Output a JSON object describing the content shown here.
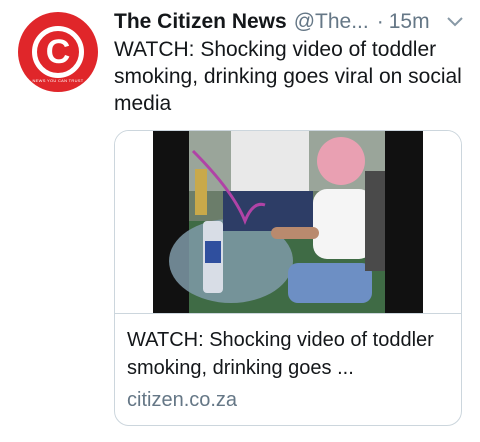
{
  "tweet": {
    "author_name": "The Citizen News",
    "handle": "@The...",
    "separator": "·",
    "time": "15m",
    "text": "WATCH: Shocking video of toddler smoking, drinking goes viral on social media"
  },
  "avatar": {
    "letter": "C",
    "tagline": "NEWS YOU CAN TRUST",
    "color": "#e0262a"
  },
  "card": {
    "title": "WATCH: Shocking video of toddler smoking, drinking goes ...",
    "domain": "citizen.co.za"
  },
  "colors": {
    "text": "#14171a",
    "muted": "#657786",
    "border": "#ccd6dd"
  },
  "icons": {
    "menu": "chevron-down-icon"
  }
}
